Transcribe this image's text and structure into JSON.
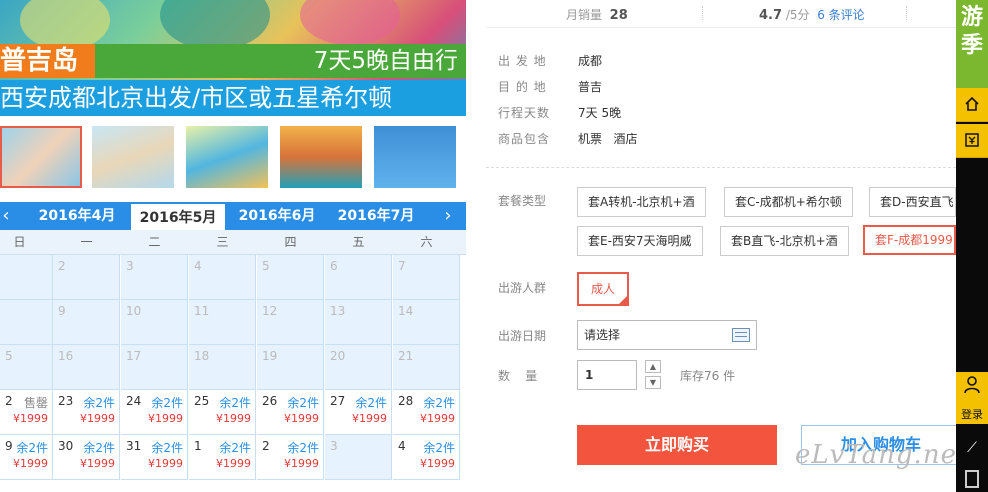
{
  "banner": {
    "title": "普吉岛",
    "subtitle": "7天5晚自由行",
    "strip": "西安成都北京出发/市区或五星希尔顿"
  },
  "thumbs": [
    {
      "text": "",
      "selected": true
    },
    {
      "text": "",
      "selected": false
    },
    {
      "text": "",
      "selected": false
    },
    {
      "text": "",
      "selected": false
    },
    {
      "text": "",
      "selected": false
    }
  ],
  "calendar": {
    "months": [
      "2016年4月",
      "2016年5月",
      "2016年6月",
      "2016年7月"
    ],
    "active_month": "2016年5月",
    "weekdays": [
      "日",
      "一",
      "二",
      "三",
      "四",
      "五",
      "六"
    ],
    "rows": [
      [
        {
          "d": "",
          "s": "",
          "p": ""
        },
        {
          "d": "2",
          "s": "",
          "p": ""
        },
        {
          "d": "3",
          "s": "",
          "p": ""
        },
        {
          "d": "4",
          "s": "",
          "p": ""
        },
        {
          "d": "5",
          "s": "",
          "p": ""
        },
        {
          "d": "6",
          "s": "",
          "p": ""
        },
        {
          "d": "7",
          "s": "",
          "p": ""
        }
      ],
      [
        {
          "d": "",
          "s": "",
          "p": ""
        },
        {
          "d": "9",
          "s": "",
          "p": ""
        },
        {
          "d": "10",
          "s": "",
          "p": ""
        },
        {
          "d": "11",
          "s": "",
          "p": ""
        },
        {
          "d": "12",
          "s": "",
          "p": ""
        },
        {
          "d": "13",
          "s": "",
          "p": ""
        },
        {
          "d": "14",
          "s": "",
          "p": ""
        }
      ],
      [
        {
          "d": "5",
          "s": "",
          "p": ""
        },
        {
          "d": "16",
          "s": "",
          "p": ""
        },
        {
          "d": "17",
          "s": "",
          "p": ""
        },
        {
          "d": "18",
          "s": "",
          "p": ""
        },
        {
          "d": "19",
          "s": "",
          "p": ""
        },
        {
          "d": "20",
          "s": "",
          "p": ""
        },
        {
          "d": "21",
          "s": "",
          "p": ""
        }
      ],
      [
        {
          "d": "2",
          "s": "售罄",
          "p": "¥1999"
        },
        {
          "d": "23",
          "s": "余2件",
          "p": "¥1999"
        },
        {
          "d": "24",
          "s": "余2件",
          "p": "¥1999"
        },
        {
          "d": "25",
          "s": "余2件",
          "p": "¥1999"
        },
        {
          "d": "26",
          "s": "余2件",
          "p": "¥1999"
        },
        {
          "d": "27",
          "s": "余2件",
          "p": "¥1999"
        },
        {
          "d": "28",
          "s": "余2件",
          "p": "¥1999"
        }
      ],
      [
        {
          "d": "9",
          "s": "余2件",
          "p": "¥1999"
        },
        {
          "d": "30",
          "s": "余2件",
          "p": "¥1999"
        },
        {
          "d": "31",
          "s": "余2件",
          "p": "¥1999"
        },
        {
          "d": "1",
          "s": "余2件",
          "p": "¥1999"
        },
        {
          "d": "2",
          "s": "余2件",
          "p": "¥1999"
        },
        {
          "d": "3",
          "s": "",
          "p": ""
        },
        {
          "d": "4",
          "s": "余2件",
          "p": "¥1999"
        }
      ]
    ]
  },
  "stats": {
    "sales_label": "月销量",
    "sales_value": "28",
    "rating_value": "4.7",
    "rating_suffix": "/5分",
    "reviews": "6 条评论"
  },
  "info": [
    {
      "k": "出 发 地",
      "v": "成都"
    },
    {
      "k": "目 的 地",
      "v": "普吉"
    },
    {
      "k": "行程天数",
      "v": "7天 5晚"
    },
    {
      "k": "商品包含",
      "v": "机票   酒店"
    }
  ],
  "package": {
    "label": "套餐类型",
    "options": [
      {
        "text": "套A转机-北京机+酒",
        "selected": false
      },
      {
        "text": "套C-成都机+希尔顿",
        "selected": false
      },
      {
        "text": "套D-西安直飞",
        "selected": false
      },
      {
        "text": "套E-西安7天海明威",
        "selected": false
      },
      {
        "text": "套B直飞-北京机+酒",
        "selected": false
      },
      {
        "text": "套F-成都1999",
        "selected": true
      }
    ]
  },
  "crowd": {
    "label": "出游人群",
    "value": "成人"
  },
  "date": {
    "label": "出游日期",
    "value": "请选择"
  },
  "quantity": {
    "label": "数    量",
    "value": "1",
    "stock": "库存76 件"
  },
  "actions": {
    "buy": "立即购买",
    "cart": "加入购物车"
  },
  "bottom_cut": "...",
  "watermark": "eLvTang.net",
  "sidebar": {
    "season": "游季",
    "login": "登录"
  },
  "colors": {
    "accent": "#f2543e",
    "link": "#2a8ee6",
    "sidebar_yellow": "#f4c100",
    "sidebar_green": "#7cb82f"
  }
}
